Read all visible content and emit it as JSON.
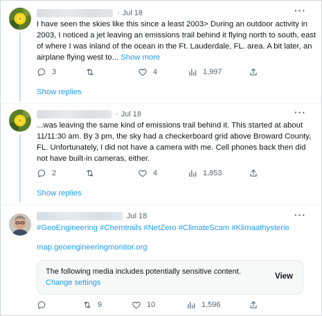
{
  "tweets": [
    {
      "date": "Jul 18",
      "text": "I have seen the skies like this since a least 2003> During an outdoor activity in 2003, I noticed a jet leaving an emissions trail behind it flying north to south, east of where I was inland of the ocean in the Ft. Lauderdale, FL. area. A bit later, an airplane flying west to...",
      "show_more": "Show more",
      "replies": "3",
      "retweets": "",
      "likes": "4",
      "views": "1,997",
      "show_replies": "Show replies"
    },
    {
      "date": "Jul 18",
      "text": "...was leaving the same kind of emissions trail behind it. This started at about 11/11:30 am. By 3 pm, the sky had a checkerboard grid above Broward County, FL. Unfortunately, I did not have a camera with me. Cell phones back then did not have built-in cameras, either.",
      "replies": "2",
      "retweets": "",
      "likes": "4",
      "views": "1,853",
      "show_replies": "Show replies"
    },
    {
      "date": "Jul 18",
      "hashtags": "#GeoEngineering #Chemtrails #NetZero #ClimateScam #Klimaathysterie",
      "url": "map.geoengineeringmonitor.org",
      "notice": {
        "text": "The following media includes potentially sensitive content.",
        "link": "Change settings",
        "view": "View"
      },
      "replies": "",
      "retweets": "9",
      "likes": "10",
      "views": "1,596"
    }
  ],
  "colors": {
    "accent": "#1d9bf0",
    "muted": "#536471",
    "text": "#0f1419"
  }
}
